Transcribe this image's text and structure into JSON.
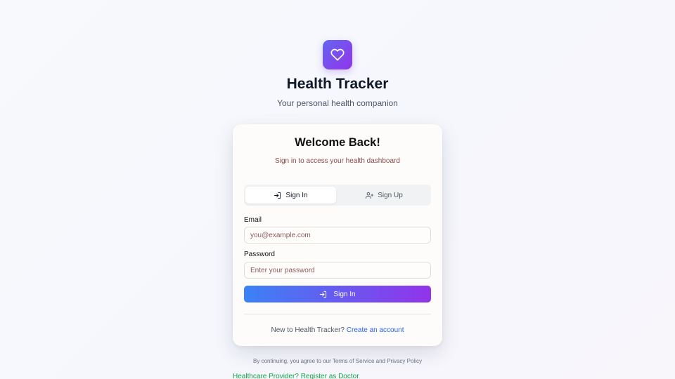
{
  "header": {
    "logo_icon": "heart-icon",
    "title": "Health Tracker",
    "subtitle": "Your personal health companion"
  },
  "card": {
    "title": "Welcome Back!",
    "subtitle": "Sign in to access your health dashboard",
    "tabs": [
      {
        "label": "Sign In",
        "icon": "log-in-icon",
        "active": true
      },
      {
        "label": "Sign Up",
        "icon": "user-plus-icon",
        "active": false
      }
    ],
    "email": {
      "label": "Email",
      "placeholder": "you@example.com",
      "value": ""
    },
    "password": {
      "label": "Password",
      "placeholder": "Enter your password",
      "value": ""
    },
    "submit_label": "Sign In",
    "footer_text": "New to Health Tracker?",
    "footer_link": "Create an account"
  },
  "legal_text": "By continuing, you agree to our Terms of Service and Privacy Policy",
  "provider_link": "Healthcare Provider? Register as Doctor",
  "colors": {
    "brand_gradient_start": "#6366f1",
    "brand_gradient_end": "#9333ea",
    "button_gradient_start": "#3b82f6",
    "link": "#2563eb",
    "provider_link": "#16a34a"
  }
}
